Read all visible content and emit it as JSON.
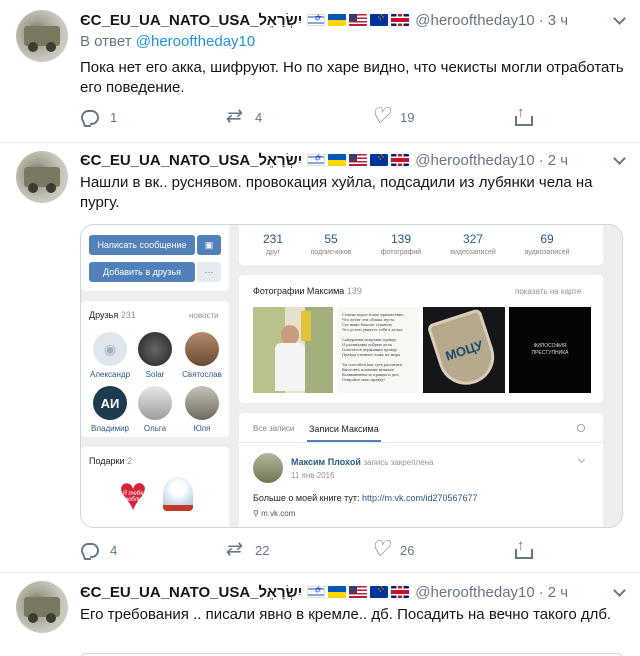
{
  "tweets": [
    {
      "name": "ЄС_EU_UA_NATO_USA_יִשְׂרָאֵל",
      "handle": "@herooftheday10",
      "dot": "·",
      "time": "3 ч",
      "reply_prefix": "В ответ",
      "reply_to": "@herooftheday10",
      "text": "Пока нет его акка, шифруют. Но по харе видно, что чекисты могли отработать его поведение.",
      "replies": "1",
      "retweets": "4",
      "likes": "19"
    },
    {
      "name": "ЄС_EU_UA_NATO_USA_יִשְׂרָאֵל",
      "handle": "@herooftheday10",
      "dot": "·",
      "time": "2 ч",
      "text": "Нашли в вк.. руснявом. провокация хуйла, подсадили из лубянки чела на пургу.",
      "replies": "4",
      "retweets": "22",
      "likes": "26"
    },
    {
      "name": "ЄС_EU_UA_NATO_USA_יִשְׂרָאֵל",
      "handle": "@herooftheday10",
      "dot": "·",
      "time": "2 ч",
      "text": "Его требования .. писали явно в кремле.. дб. Посадить на вечно такого длб."
    }
  ],
  "vk": {
    "btn_message": "Написать сообщение",
    "btn_add": "Добавить в друзья",
    "btn_more": "···",
    "stats": [
      {
        "num": "231",
        "label": "друг"
      },
      {
        "num": "55",
        "label": "подписчиков"
      },
      {
        "num": "139",
        "label": "фотографий"
      },
      {
        "num": "327",
        "label": "видеозаписей"
      },
      {
        "num": "69",
        "label": "аудиозаписей"
      }
    ],
    "friends_title": "Друзья",
    "friends_count": "231",
    "friends_news": "новости",
    "friends": [
      "Александр",
      "Solar",
      "Святослав",
      "Владимир",
      "Ольга",
      "Юля"
    ],
    "friend_initials": "АИ",
    "gifts_title": "Подарки",
    "gifts_count": "2",
    "gift_text": "Я тебя люблю",
    "photos_title": "Фотографии Максима",
    "photos_count": "139",
    "show_on_map": "показать на карте",
    "poem_lines": [
      "Солнце ворот в мое пришествие,",
      "Что летят эти облака пусть,",
      "Где ныне благою страною",
      "Что устою увидеть тебя в делах.",
      "",
      "Самураевы исправят правду",
      "И раскиданы добрые дела",
      "Осветятся держащие правду",
      "Правда отнимет ложь из мира",
      "",
      "Ты способен как суть распятия,",
      "Выстоять пламени великое",
      "Возвышенность правды и дел,",
      "Откройте мою правду!"
    ],
    "logo_text": "МОЦУ",
    "book_title": "ФИЛОСОФИЯ ПРЕСТУПНИКА",
    "tab_all": "Все записи",
    "tab_max": "Записи Максима",
    "post_author": "Максим Плохой",
    "post_pinned": "запись закреплена",
    "post_date": "11 янв 2016",
    "post_text": "Больше о моей книге тут:",
    "post_link": "http://m.vk.com/id270567677",
    "post_source": "m.vk.com",
    "accent": "#5181b8"
  },
  "colors": {
    "link": "#1b95e0",
    "muted": "#657786",
    "text": "#14171a"
  }
}
